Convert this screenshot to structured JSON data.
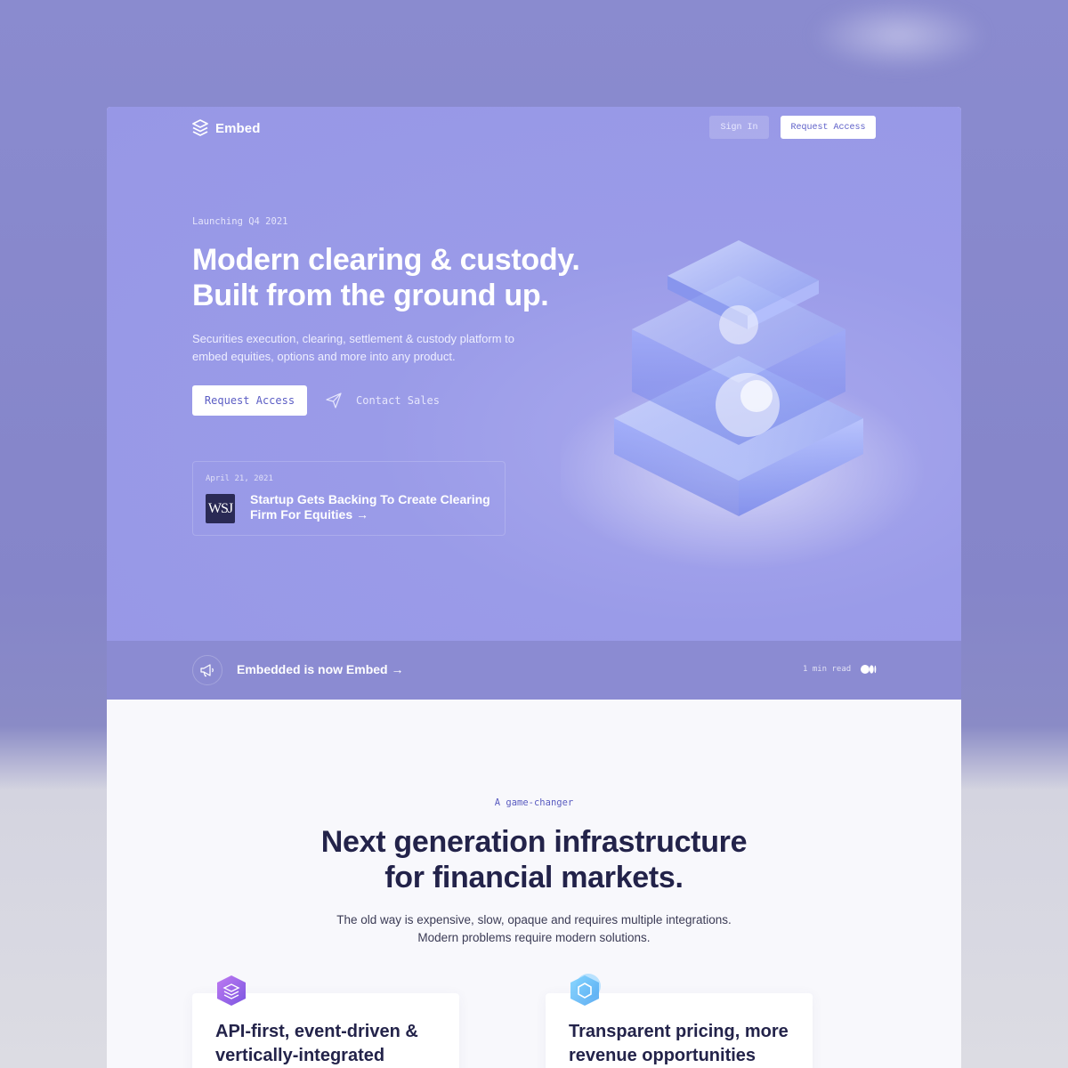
{
  "nav": {
    "brand": "Embed",
    "sign_in": "Sign In",
    "request_access": "Request Access"
  },
  "hero": {
    "eyebrow": "Launching Q4 2021",
    "headline_line1": "Modern clearing & custody.",
    "headline_line2": "Built from the ground up.",
    "description": "Securities execution, clearing, settlement & custody platform to embed equities, options and more into any product.",
    "cta_primary": "Request Access",
    "cta_secondary": "Contact Sales",
    "news": {
      "date": "April 21, 2021",
      "source_logo": "WSJ",
      "title": "Startup Gets Backing To Create Clearing Firm For Equities",
      "arrow": "→"
    }
  },
  "announcement": {
    "text": "Embedded is now Embed",
    "arrow": "→",
    "read_time": "1 min read",
    "icon": "megaphone-icon"
  },
  "features_section": {
    "eyebrow": "A game-changer",
    "title_line1": "Next generation infrastructure",
    "title_line2": "for financial markets.",
    "subtitle_line1": "The old way is expensive, slow, opaque and requires multiple integrations.",
    "subtitle_line2": "Modern problems require modern solutions.",
    "cards": [
      {
        "title_line1": "API-first, event-driven &",
        "title_line2": "vertically-integrated",
        "icon": "layers-icon"
      },
      {
        "title_line1": "Transparent pricing, more",
        "title_line2": "revenue opportunities",
        "icon": "hexagon-icon"
      }
    ]
  },
  "colors": {
    "hero_bg": "#9797e6",
    "announce_bg": "#8b8bd2",
    "heading_dark": "#23234a",
    "accent": "#5a5cc0"
  }
}
